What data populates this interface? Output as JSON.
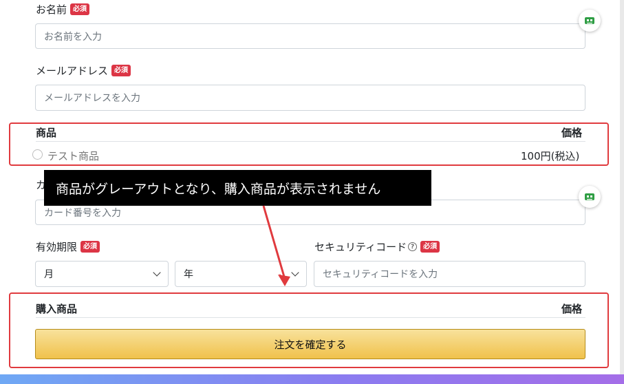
{
  "form": {
    "name": {
      "label": "お名前",
      "required": "必須",
      "placeholder": "お名前を入力"
    },
    "email": {
      "label": "メールアドレス",
      "required": "必須",
      "placeholder": "メールアドレスを入力"
    },
    "card": {
      "label_partial": "カ",
      "placeholder": "カード番号を入力"
    },
    "expiry": {
      "label": "有効期限",
      "required": "必須",
      "month": "月",
      "year": "年"
    },
    "security": {
      "label": "セキュリティコード",
      "help": "?",
      "required": "必須",
      "placeholder": "セキュリティコードを入力"
    }
  },
  "products": {
    "header_product": "商品",
    "header_price": "価格",
    "item": {
      "name": "テスト商品",
      "price": "100円(税込)"
    }
  },
  "purchase": {
    "header_product": "購入商品",
    "header_price": "価格",
    "confirm_label": "注文を確定する"
  },
  "annotation": {
    "callout": "商品がグレーアウトとなり、購入商品が表示されません",
    "color": "#e03a3e"
  },
  "icons": {
    "floating_button": "robot-face-icon"
  }
}
